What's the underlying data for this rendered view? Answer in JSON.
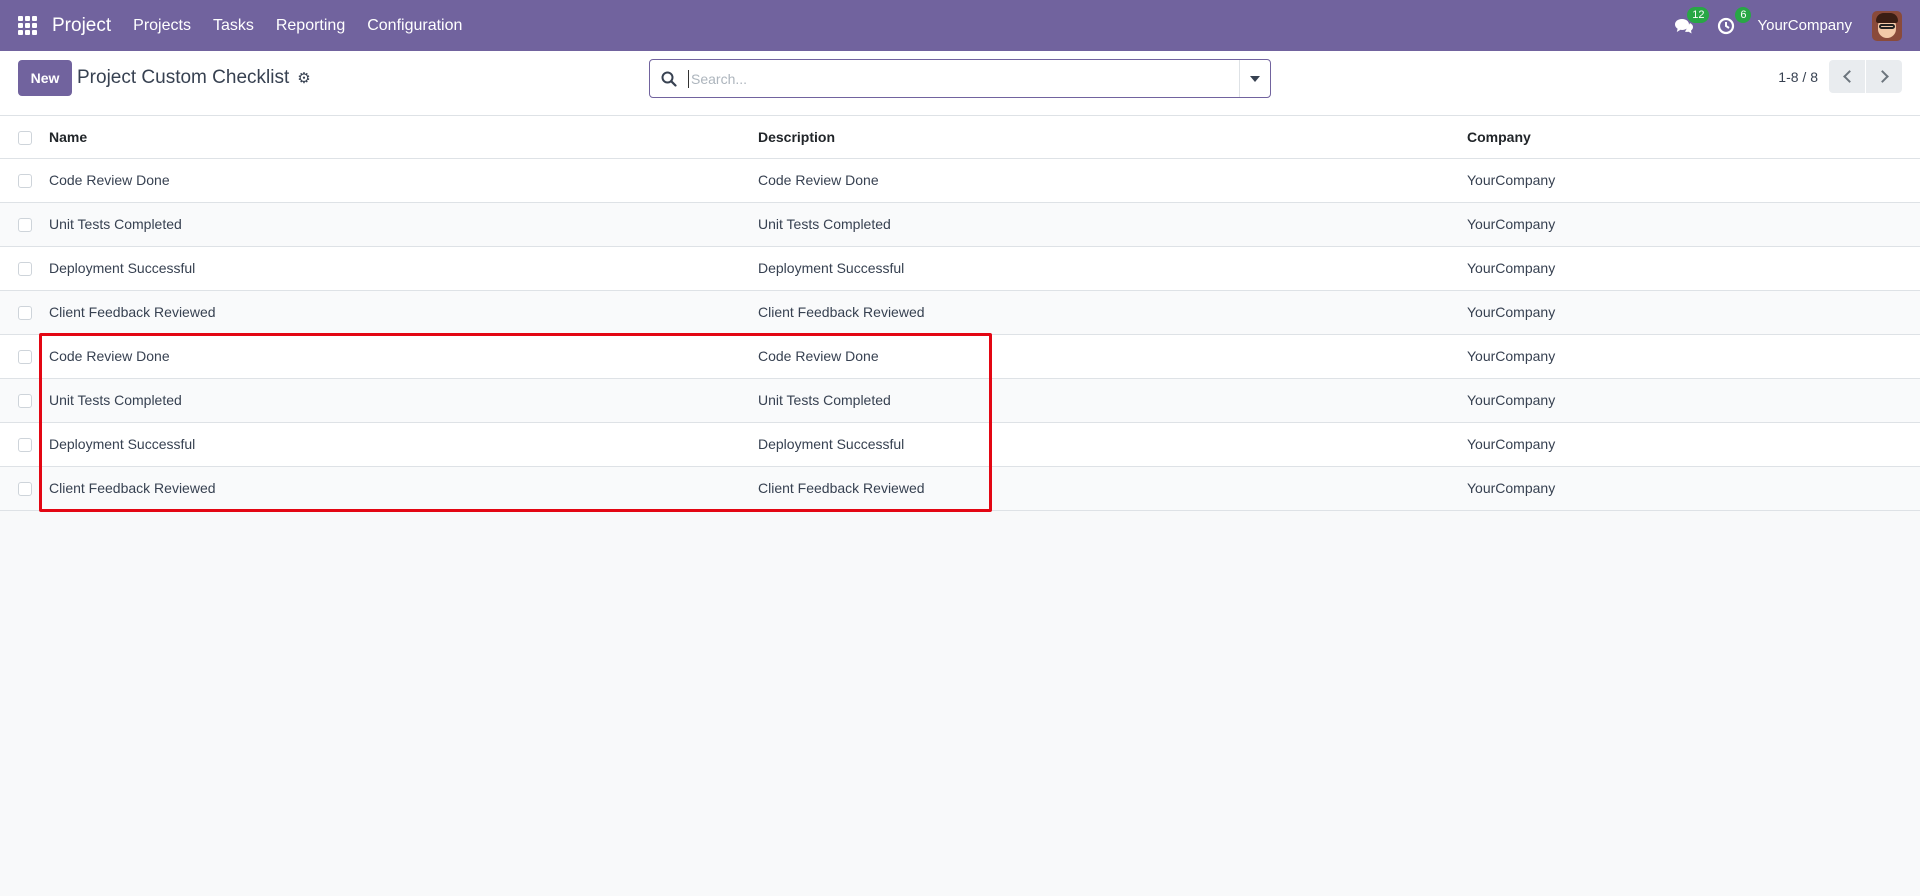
{
  "navbar": {
    "app_name": "Project",
    "menu": [
      "Projects",
      "Tasks",
      "Reporting",
      "Configuration"
    ],
    "messages_count": "12",
    "activities_count": "6",
    "company": "YourCompany"
  },
  "control_panel": {
    "new_label": "New",
    "title": "Project Custom Checklist",
    "search_placeholder": "Search...",
    "pager_value": "1-8 / 8"
  },
  "table": {
    "columns": [
      "Name",
      "Description",
      "Company"
    ],
    "rows": [
      [
        "Code Review Done",
        "Code Review Done",
        "YourCompany"
      ],
      [
        "Unit Tests Completed",
        "Unit Tests Completed",
        "YourCompany"
      ],
      [
        "Deployment Successful",
        "Deployment Successful",
        "YourCompany"
      ],
      [
        "Client Feedback Reviewed",
        "Client Feedback Reviewed",
        "YourCompany"
      ],
      [
        "Code Review Done",
        "Code Review Done",
        "YourCompany"
      ],
      [
        "Unit Tests Completed",
        "Unit Tests Completed",
        "YourCompany"
      ],
      [
        "Deployment Successful",
        "Deployment Successful",
        "YourCompany"
      ],
      [
        "Client Feedback Reviewed",
        "Client Feedback Reviewed",
        "YourCompany"
      ]
    ]
  },
  "colors": {
    "brand": "#71639e",
    "badge": "#28a745",
    "highlight": "#e30613"
  },
  "icons": [
    "apps-grid-icon",
    "chat-icon",
    "clock-icon",
    "gear-icon",
    "search-icon",
    "caret-down-icon",
    "chevron-left-icon",
    "chevron-right-icon"
  ]
}
